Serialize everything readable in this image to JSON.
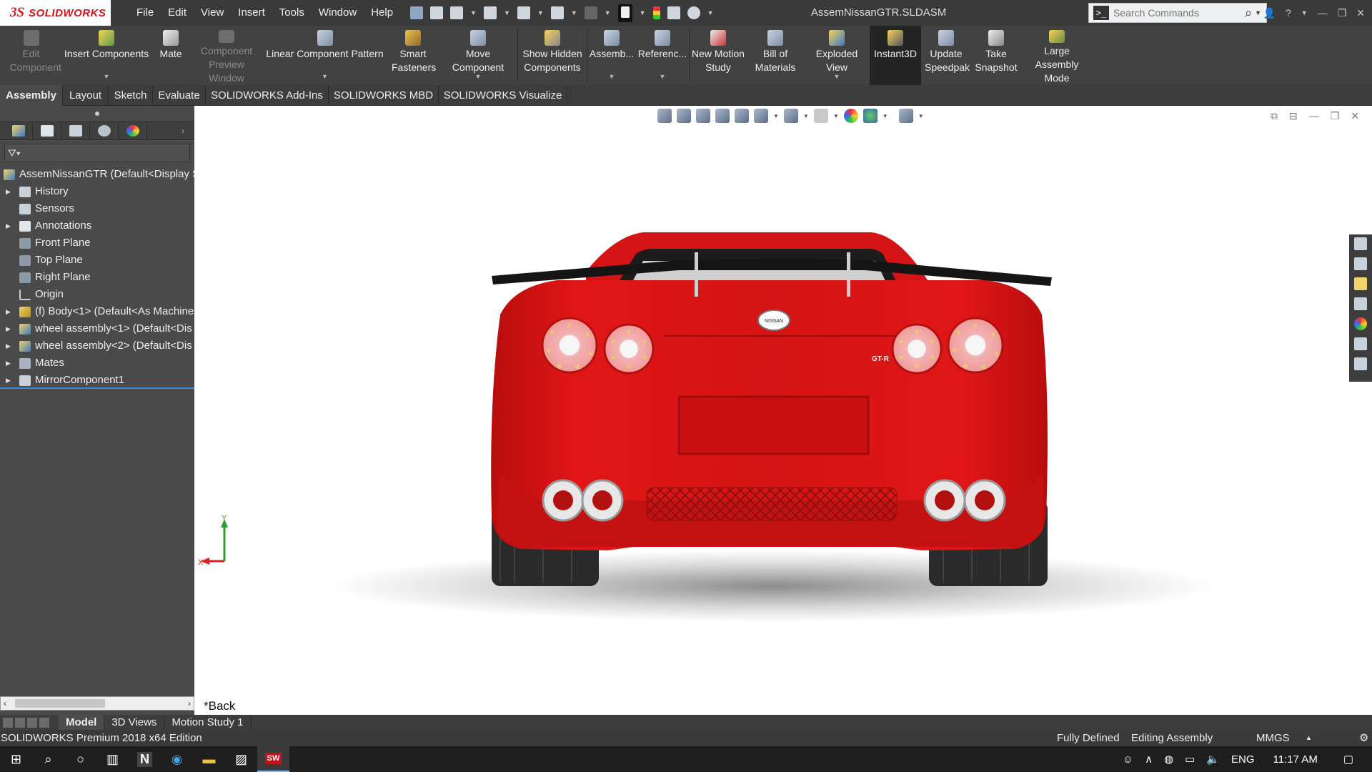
{
  "app": {
    "name": "SOLIDWORKS",
    "doc_title": "AssemNissanGTR.SLDASM"
  },
  "menu": [
    "File",
    "Edit",
    "View",
    "Insert",
    "Tools",
    "Window",
    "Help"
  ],
  "search": {
    "placeholder": "Search Commands"
  },
  "commands": [
    {
      "id": "edit-component",
      "label": "Edit Component",
      "disabled": true
    },
    {
      "id": "insert-components",
      "label": "Insert Components"
    },
    {
      "id": "mate",
      "label": "Mate"
    },
    {
      "id": "component-preview-window",
      "label": "Component Preview Window",
      "disabled": true
    },
    {
      "id": "linear-component-pattern",
      "label": "Linear Component Pattern"
    },
    {
      "id": "smart-fasteners",
      "label": "Smart Fasteners"
    },
    {
      "id": "move-component",
      "label": "Move Component"
    },
    {
      "id": "show-hidden-components",
      "label": "Show Hidden Components"
    },
    {
      "id": "assembly-features",
      "label": "Assemb..."
    },
    {
      "id": "reference-geometry",
      "label": "Referenc..."
    },
    {
      "id": "new-motion-study",
      "label": "New Motion Study"
    },
    {
      "id": "bill-of-materials",
      "label": "Bill of Materials"
    },
    {
      "id": "exploded-view",
      "label": "Exploded View"
    },
    {
      "id": "instant3d",
      "label": "Instant3D"
    },
    {
      "id": "update-speedpak",
      "label": "Update Speedpak"
    },
    {
      "id": "take-snapshot",
      "label": "Take Snapshot"
    },
    {
      "id": "large-assembly-mode",
      "label": "Large Assembly Mode"
    }
  ],
  "tabs": [
    "Assembly",
    "Layout",
    "Sketch",
    "Evaluate",
    "SOLIDWORKS Add-Ins",
    "SOLIDWORKS MBD",
    "SOLIDWORKS Visualize"
  ],
  "tree": [
    {
      "label": "AssemNissanGTR  (Default<Display S"
    },
    {
      "label": "History"
    },
    {
      "label": "Sensors"
    },
    {
      "label": "Annotations"
    },
    {
      "label": "Front Plane"
    },
    {
      "label": "Top Plane"
    },
    {
      "label": "Right Plane"
    },
    {
      "label": "Origin"
    },
    {
      "label": "(f) Body<1> (Default<As Machine"
    },
    {
      "label": "wheel assembly<1> (Default<Dis"
    },
    {
      "label": "wheel assembly<2> (Default<Dis"
    },
    {
      "label": "Mates"
    },
    {
      "label": "MirrorComponent1"
    }
  ],
  "viewport": {
    "view_name": "*Back",
    "triad": {
      "x": "X",
      "y": "Y"
    },
    "model": {
      "badge": "NISSAN",
      "emblem": "GT-R",
      "color": "#d41414"
    }
  },
  "bottom_tabs": [
    "Model",
    "3D Views",
    "Motion Study 1"
  ],
  "status": {
    "edition": "SOLIDWORKS Premium 2018 x64 Edition",
    "definition": "Fully Defined",
    "mode": "Editing Assembly",
    "units": "MMGS"
  },
  "taskbar": {
    "lang": "ENG",
    "time": "11:17 AM"
  },
  "colors": {
    "titlebar": "#3a3a3a",
    "ribbon": "#424242",
    "panel": "#4a4a4a",
    "brand_red": "#d6121a",
    "car_red": "#d41414",
    "selection": "#3c87d5"
  }
}
